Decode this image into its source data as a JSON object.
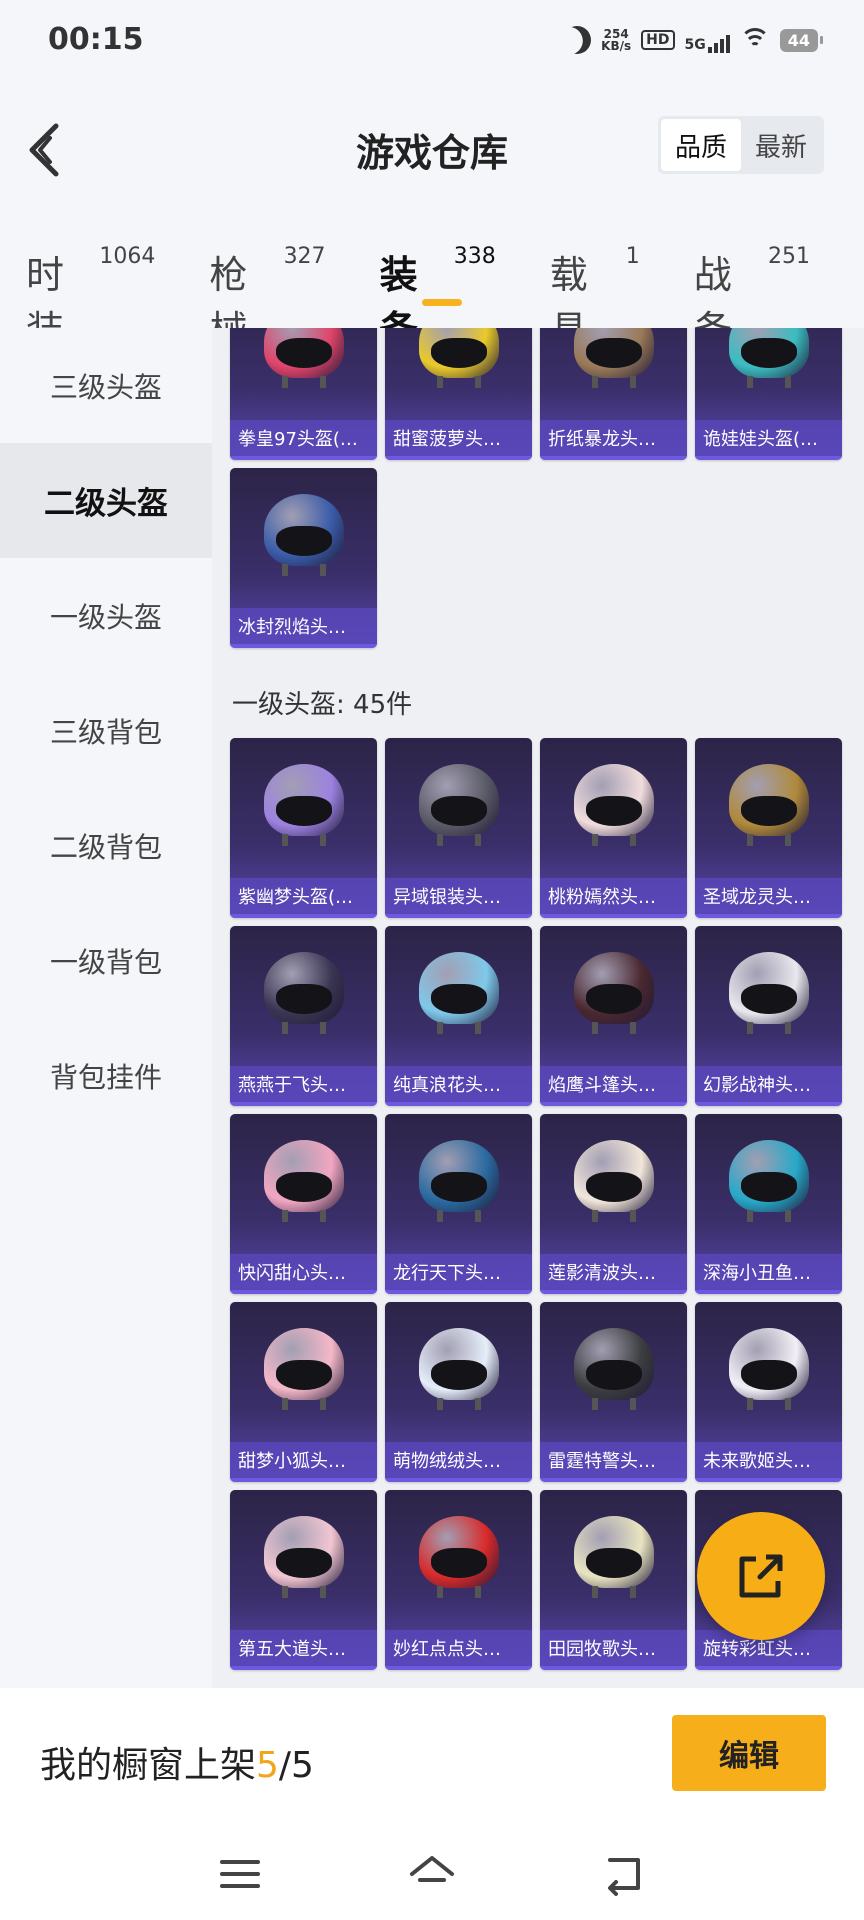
{
  "status_bar": {
    "time": "00:15",
    "net_speed_value": "254",
    "net_speed_unit": "KB/s",
    "hd_label": "HD",
    "network_label": "5G",
    "battery": "44"
  },
  "header": {
    "title": "游戏仓库",
    "sort_options": [
      "品质",
      "最新"
    ],
    "sort_selected": "品质"
  },
  "category_tabs": [
    {
      "label": "时装",
      "count": "1064"
    },
    {
      "label": "枪械",
      "count": "327"
    },
    {
      "label": "装备",
      "count": "338",
      "active": true
    },
    {
      "label": "载具",
      "count": "1"
    },
    {
      "label": "战备",
      "count": "251"
    }
  ],
  "sidebar": {
    "items": [
      "三级头盔",
      "二级头盔",
      "一级头盔",
      "三级背包",
      "二级背包",
      "一级背包",
      "背包挂件"
    ],
    "active": "二级头盔"
  },
  "level2_items": [
    {
      "name": "拳皇97头盔(…",
      "dome": "#e0446a"
    },
    {
      "name": "甜蜜菠萝头…",
      "dome": "#e9c92a"
    },
    {
      "name": "折纸暴龙头…",
      "dome": "#9a7a58"
    },
    {
      "name": "诡娃娃头盔(…",
      "dome": "#3bbcc0"
    },
    {
      "name": "冰封烈焰头…",
      "dome": "#3a5ca8"
    }
  ],
  "level1_section": {
    "title": "一级头盔: 45件",
    "items": [
      {
        "name": "紫幽梦头盔(…",
        "dome": "#9c82e0"
      },
      {
        "name": "异域银装头…",
        "dome": "#5a5a66"
      },
      {
        "name": "桃粉嫣然头…",
        "dome": "#f0dcdc"
      },
      {
        "name": "圣域龙灵头…",
        "dome": "#b08a3a"
      },
      {
        "name": "燕燕于飞头…",
        "dome": "#3a3552"
      },
      {
        "name": "纯真浪花头…",
        "dome": "#7fc8ea"
      },
      {
        "name": "焰鹰斗篷头…",
        "dome": "#4a2830"
      },
      {
        "name": "幻影战神头…",
        "dome": "#e8e8ee"
      },
      {
        "name": "快闪甜心头…",
        "dome": "#f2a6c0"
      },
      {
        "name": "龙行天下头…",
        "dome": "#2a6aa0"
      },
      {
        "name": "莲影清波头…",
        "dome": "#f1e6da"
      },
      {
        "name": "深海小丑鱼…",
        "dome": "#28a8c8"
      },
      {
        "name": "甜梦小狐头…",
        "dome": "#f4b8c8"
      },
      {
        "name": "萌物绒绒头…",
        "dome": "#e6eefa"
      },
      {
        "name": "雷霆特警头…",
        "dome": "#3c3e40"
      },
      {
        "name": "未来歌姬头…",
        "dome": "#f2f0f6"
      },
      {
        "name": "第五大道头…",
        "dome": "#f2c6d2"
      },
      {
        "name": "妙红点点头…",
        "dome": "#d82a2a"
      },
      {
        "name": "田园牧歌头…",
        "dome": "#e8e4c0"
      },
      {
        "name": "旋转彩虹头…",
        "dome": "#d0d0e8"
      }
    ]
  },
  "bottom_bar": {
    "shelf_prefix": "我的橱窗上架",
    "shelf_current": "5",
    "shelf_total": "/5",
    "edit_label": "编辑"
  },
  "colors": {
    "accent": "#f7b21e",
    "card_bg": "#3a2f6a",
    "card_label_bg": "#5a48be"
  }
}
